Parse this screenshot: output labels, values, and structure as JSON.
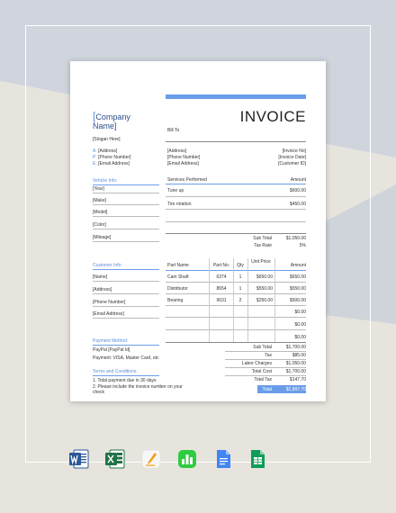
{
  "invoice": {
    "company_bracket": "[",
    "company_name": "Company Name]",
    "slogan": "[Slogan Here]",
    "address_label": "A:",
    "address": "[Address]",
    "phone_label": "P:",
    "phone": "[Phone Number]",
    "email_label": "E:",
    "email": "[Email Address]",
    "title": "INVOICE",
    "bill_to": "Bill To",
    "bill_address": "[Address]",
    "bill_phone": "[Phone Number]",
    "bill_email": "[Email Address]",
    "invoice_no": "[Invoice No]",
    "invoice_date": "[Invoice Date]",
    "customer_id": "[Customer ID]",
    "vehicle_info_label": "Vehicle Info:",
    "vehicle_fields": [
      "[Year]",
      "[Make]",
      "[Model]",
      "[Color]",
      "[Mileage]"
    ],
    "services_header": "Services Performed",
    "amount_header": "Amount",
    "services": [
      {
        "name": "Tune up",
        "amount": "$600.00"
      },
      {
        "name": "Tire rotation",
        "amount": "$450.00"
      }
    ],
    "services_subtotal_label": "Sub Total",
    "services_subtotal": "$1,050.00",
    "tax_rate_label": "Tax Rate",
    "tax_rate": "5%",
    "customer_info_label": "Customer Info:",
    "customer_fields": [
      "[Name]",
      "[Address]",
      "[Phone Number]",
      "[Email Address]"
    ],
    "parts_headers": {
      "part_name": "Part Name",
      "part_no": "Part No.",
      "qty": "Qty",
      "unit_price": "Unit Price",
      "amount": "Amount"
    },
    "parts": [
      {
        "name": "Cam Shaft",
        "no": "6374",
        "qty": "1",
        "unit": "$650.00",
        "amount": "$650.00"
      },
      {
        "name": "Distributor",
        "no": "8654",
        "qty": "1",
        "unit": "$550.00",
        "amount": "$550.00"
      },
      {
        "name": "Bearing",
        "no": "9631",
        "qty": "2",
        "unit": "$250.00",
        "amount": "$500.00"
      }
    ],
    "empty_amounts": [
      "$0.00",
      "$0.00",
      "$0.00"
    ],
    "payment_method_label": "Payment Method:",
    "paypal": "PayPal [PayPal Id]",
    "payment_options": "Payment: VISA, Master Card, etc",
    "terms_label": "Terms and Conditions:",
    "terms": [
      "1. Total payment due in 30 days",
      "2. Please include the invoice number on your",
      "check"
    ],
    "summary": [
      {
        "label": "Sub Total",
        "value": "$1,700.00"
      },
      {
        "label": "Tax",
        "value": "$85.00"
      },
      {
        "label": "Labor Charges",
        "value": "$1,050.00"
      },
      {
        "label": "Total Cost",
        "value": "$1,700.00"
      },
      {
        "label": "Total Tax",
        "value": "$147.70"
      }
    ],
    "total_label": "Total",
    "total_value": "$2,897.70"
  },
  "icons": [
    "word-icon",
    "excel-icon",
    "pages-icon",
    "numbers-icon",
    "google-docs-icon",
    "google-sheets-icon"
  ],
  "colors": {
    "accent": "#6a9de8",
    "company": "#2b4e8c",
    "word": "#2b579a",
    "excel": "#217346",
    "pages": "#f39c12",
    "numbers": "#2ecc40",
    "gdocs": "#4285f4",
    "gsheets": "#0f9d58"
  }
}
